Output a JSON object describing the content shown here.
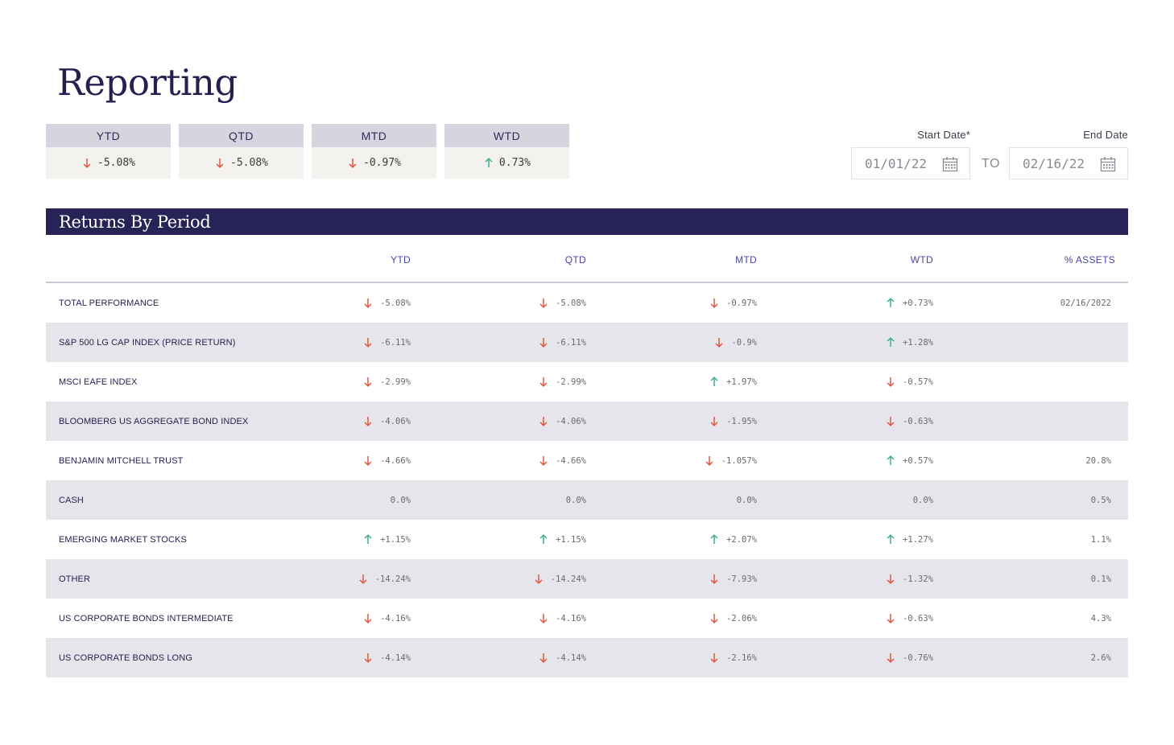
{
  "page": {
    "title": "Reporting"
  },
  "summary": [
    {
      "label": "YTD",
      "value": "-5.08%",
      "direction": "down"
    },
    {
      "label": "QTD",
      "value": "-5.08%",
      "direction": "down"
    },
    {
      "label": "MTD",
      "value": "-0.97%",
      "direction": "down"
    },
    {
      "label": "WTD",
      "value": "0.73%",
      "direction": "up"
    }
  ],
  "dates": {
    "start_label": "Start Date*",
    "start_value": "01/01/22",
    "to_label": "TO",
    "end_label": "End Date",
    "end_value": "02/16/22"
  },
  "table": {
    "title": "Returns By Period",
    "columns": [
      "YTD",
      "QTD",
      "MTD",
      "WTD",
      "% ASSETS"
    ],
    "rows": [
      {
        "name": "TOTAL PERFORMANCE",
        "ytd": "-5.08%",
        "ytd_dir": "down",
        "qtd": "-5.08%",
        "qtd_dir": "down",
        "mtd": "-0.97%",
        "mtd_dir": "down",
        "wtd": "+0.73%",
        "wtd_dir": "up",
        "assets": "02/16/2022"
      },
      {
        "name": "S&P 500 LG CAP INDEX (PRICE RETURN)",
        "ytd": "-6.11%",
        "ytd_dir": "down",
        "qtd": "-6.11%",
        "qtd_dir": "down",
        "mtd": "-0.9%",
        "mtd_dir": "down",
        "wtd": "+1.28%",
        "wtd_dir": "up",
        "assets": ""
      },
      {
        "name": "MSCI EAFE INDEX",
        "ytd": "-2.99%",
        "ytd_dir": "down",
        "qtd": "-2.99%",
        "qtd_dir": "down",
        "mtd": "+1.97%",
        "mtd_dir": "up",
        "wtd": "-0.57%",
        "wtd_dir": "down",
        "assets": ""
      },
      {
        "name": "BLOOMBERG US AGGREGATE BOND INDEX",
        "ytd": "-4.06%",
        "ytd_dir": "down",
        "qtd": "-4.06%",
        "qtd_dir": "down",
        "mtd": "-1.95%",
        "mtd_dir": "down",
        "wtd": "-0.63%",
        "wtd_dir": "down",
        "assets": ""
      },
      {
        "name": "BENJAMIN MITCHELL TRUST",
        "ytd": "-4.66%",
        "ytd_dir": "down",
        "qtd": "-4.66%",
        "qtd_dir": "down",
        "mtd": "-1.057%",
        "mtd_dir": "down",
        "wtd": "+0.57%",
        "wtd_dir": "up",
        "assets": "20.8%"
      },
      {
        "name": "CASH",
        "ytd": "0.0%",
        "ytd_dir": "none",
        "qtd": "0.0%",
        "qtd_dir": "none",
        "mtd": "0.0%",
        "mtd_dir": "none",
        "wtd": "0.0%",
        "wtd_dir": "none",
        "assets": "0.5%"
      },
      {
        "name": "EMERGING MARKET STOCKS",
        "ytd": "+1.15%",
        "ytd_dir": "up",
        "qtd": "+1.15%",
        "qtd_dir": "up",
        "mtd": "+2.07%",
        "mtd_dir": "up",
        "wtd": "+1.27%",
        "wtd_dir": "up",
        "assets": "1.1%"
      },
      {
        "name": "OTHER",
        "ytd": "-14.24%",
        "ytd_dir": "down",
        "qtd": "-14.24%",
        "qtd_dir": "down",
        "mtd": "-7.93%",
        "mtd_dir": "down",
        "wtd": "-1.32%",
        "wtd_dir": "down",
        "assets": "0.1%"
      },
      {
        "name": "US CORPORATE BONDS INTERMEDIATE",
        "ytd": "-4.16%",
        "ytd_dir": "down",
        "qtd": "-4.16%",
        "qtd_dir": "down",
        "mtd": "-2.06%",
        "mtd_dir": "down",
        "wtd": "-0.63%",
        "wtd_dir": "down",
        "assets": "4.3%"
      },
      {
        "name": "US CORPORATE BONDS LONG",
        "ytd": "-4.14%",
        "ytd_dir": "down",
        "qtd": "-4.14%",
        "qtd_dir": "down",
        "mtd": "-2.16%",
        "mtd_dir": "down",
        "wtd": "-0.76%",
        "wtd_dir": "down",
        "assets": "2.6%"
      }
    ]
  },
  "colors": {
    "down": "#e0573e",
    "up": "#3fae91",
    "header_bg": "#282356",
    "accent": "#4a46a0"
  },
  "icons": {
    "down": "arrow-down-icon",
    "up": "arrow-up-icon",
    "calendar": "calendar-icon"
  }
}
